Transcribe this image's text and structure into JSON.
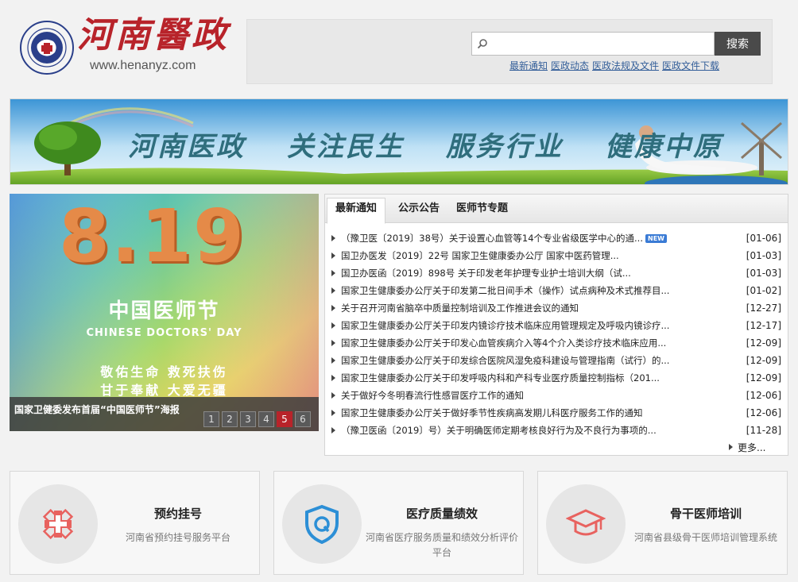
{
  "header": {
    "logo_title": "河南醫政",
    "logo_url": "www.henanyz.com"
  },
  "search": {
    "placeholder": "",
    "button_label": "搜索",
    "links": [
      "最新通知",
      "医政动态",
      "医政法规及文件",
      "医政文件下载"
    ]
  },
  "banner": {
    "slogans": [
      "河南医政",
      "关注民生",
      "服务行业",
      "健康中原"
    ]
  },
  "slideshow": {
    "big_number": "8.19",
    "cn_title": "中国医师节",
    "en_title": "CHINESE DOCTORS' DAY",
    "slogan1": "敬佑生命 救死扶伤",
    "slogan2": "甘于奉献 大爱无疆",
    "caption": "国家卫健委发布首届“中国医师节”海报",
    "pages": [
      "1",
      "2",
      "3",
      "4",
      "5",
      "6"
    ],
    "active_page": 5
  },
  "notices": {
    "tabs": [
      "最新通知",
      "公示公告",
      "医师节专题"
    ],
    "active_tab": 0,
    "items": [
      {
        "title": "（豫卫医〔2019〕38号）关于设置心血管等14个专业省级医学中心的通...",
        "date": "[01-06]",
        "badge": "NEW"
      },
      {
        "title": "国卫办医发〔2019〕22号 国家卫生健康委办公厅 国家中医药管理...",
        "date": "[01-03]"
      },
      {
        "title": "国卫办医函〔2019〕898号 关于印发老年护理专业护士培训大纲（试...",
        "date": "[01-03]"
      },
      {
        "title": "国家卫生健康委办公厅关于印发第二批日间手术（操作）试点病种及术式推荐目...",
        "date": "[01-02]"
      },
      {
        "title": "关于召开河南省脑卒中质量控制培训及工作推进会议的通知",
        "date": "[12-27]"
      },
      {
        "title": "国家卫生健康委办公厅关于印发内镜诊疗技术临床应用管理规定及呼吸内镜诊疗...",
        "date": "[12-17]"
      },
      {
        "title": "国家卫生健康委办公厅关于印发心血管疾病介入等4个介入类诊疗技术临床应用...",
        "date": "[12-09]"
      },
      {
        "title": "国家卫生健康委办公厅关于印发综合医院风湿免疫科建设与管理指南（试行）的...",
        "date": "[12-09]"
      },
      {
        "title": "国家卫生健康委办公厅关于印发呼吸内科和产科专业医疗质量控制指标（201...",
        "date": "[12-09]"
      },
      {
        "title": "关于做好今冬明春流行性感冒医疗工作的通知",
        "date": "[12-06]"
      },
      {
        "title": "国家卫生健康委办公厅关于做好季节性疾病高发期儿科医疗服务工作的通知",
        "date": "[12-06]"
      },
      {
        "title": "（豫卫医函〔2019〕号）关于明确医师定期考核良好行为及不良行为事项的...",
        "date": "[11-28]"
      }
    ],
    "more_label": "更多..."
  },
  "services": [
    {
      "title": "预约挂号",
      "desc": "河南省预约挂号服务平台",
      "icon": "hospital-cross-icon",
      "color": "#e8625f"
    },
    {
      "title": "医疗质量绩效",
      "desc": "河南省医疗服务质量和绩效分析评价平台",
      "icon": "shield-q-icon",
      "color": "#2c8fd6"
    },
    {
      "title": "骨干医师培训",
      "desc": "河南省县级骨干医师培训管理系统",
      "icon": "graduation-cap-icon",
      "color": "#e8625f"
    }
  ]
}
